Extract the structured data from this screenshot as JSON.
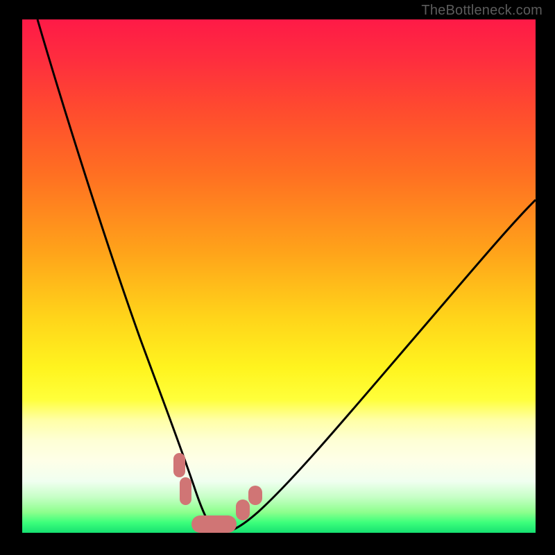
{
  "attribution": "TheBottleneck.com",
  "colors": {
    "blob": "#d07575",
    "curve": "#000000",
    "frame": "#000000"
  },
  "chart_data": {
    "type": "line",
    "title": "",
    "xlabel": "",
    "ylabel": "",
    "xlim": [
      0,
      100
    ],
    "ylim": [
      0,
      100
    ],
    "legend": false,
    "grid": false,
    "series": [
      {
        "name": "left-curve",
        "x": [
          3,
          8,
          13,
          18,
          22,
          26,
          29,
          31,
          33,
          34.5,
          36,
          37
        ],
        "values": [
          100,
          82,
          65,
          49,
          35,
          23,
          14,
          8,
          4,
          1.5,
          0,
          0
        ]
      },
      {
        "name": "right-curve",
        "x": [
          37,
          40,
          44,
          50,
          58,
          68,
          80,
          92,
          100
        ],
        "values": [
          0,
          0,
          2,
          7,
          15,
          27,
          42,
          56,
          65
        ]
      }
    ],
    "annotations": [
      {
        "name": "blob-left-upper",
        "x_range": [
          29.5,
          31.5
        ],
        "y_range": [
          10,
          16
        ]
      },
      {
        "name": "blob-left-lower",
        "x_range": [
          30.5,
          32.5
        ],
        "y_range": [
          5,
          10
        ]
      },
      {
        "name": "blob-bottom",
        "x_range": [
          33,
          41
        ],
        "y_range": [
          0,
          3
        ]
      },
      {
        "name": "blob-right-lower",
        "x_range": [
          42,
          44.5
        ],
        "y_range": [
          2.5,
          6.5
        ]
      },
      {
        "name": "blob-right-upper",
        "x_range": [
          44.5,
          47
        ],
        "y_range": [
          5.5,
          9.5
        ]
      }
    ]
  }
}
